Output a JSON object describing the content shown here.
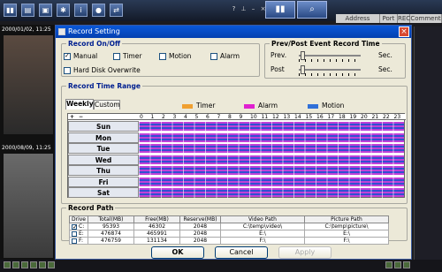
{
  "background": {
    "table_headers": [
      "Address",
      "Port",
      "REC",
      "Comment"
    ],
    "camera_timestamps": [
      "2000/01/02, 11:25",
      "2000/08/09, 11:25"
    ]
  },
  "dialog": {
    "title": "Record Setting",
    "close_glyph": "×",
    "record_onoff": {
      "legend": "Record On/Off",
      "options": [
        {
          "label": "Manual",
          "checked": true
        },
        {
          "label": "Timer",
          "checked": false
        },
        {
          "label": "Motion",
          "checked": false
        },
        {
          "label": "Alarm",
          "checked": false
        }
      ],
      "hdd_overwrite": {
        "label": "Hard Disk Overwrite",
        "checked": false
      }
    },
    "prepost": {
      "legend": "Prev/Post Event Record Time",
      "prev_label": "Prev.",
      "post_label": "Post",
      "unit": "Sec."
    },
    "time_range": {
      "legend": "Record Time Range",
      "tabs": [
        "Weekly",
        "Custom"
      ],
      "active_tab": "Weekly",
      "legend_items": [
        {
          "label": "Timer",
          "color": "#f0a030"
        },
        {
          "label": "Alarm",
          "color": "#e020d0"
        },
        {
          "label": "Motion",
          "color": "#3070d8"
        }
      ],
      "add_glyph": "+",
      "remove_glyph": "−",
      "hours": [
        "0",
        "1",
        "2",
        "3",
        "4",
        "5",
        "6",
        "7",
        "8",
        "9",
        "10",
        "11",
        "12",
        "13",
        "14",
        "15",
        "16",
        "17",
        "18",
        "19",
        "20",
        "21",
        "22",
        "23"
      ],
      "days": [
        "Sun",
        "Mon",
        "Tue",
        "Wed",
        "Thu",
        "Fri",
        "Sat"
      ]
    },
    "record_path": {
      "legend": "Record Path",
      "headers": [
        "Drive",
        "Total(MB)",
        "Free(MB)",
        "Reserve(MB)",
        "Video Path",
        "Picture Path"
      ],
      "rows": [
        {
          "checked": true,
          "drive": "C:",
          "total": "95393",
          "free": "46302",
          "reserve": "2048",
          "video": "C:\\temp\\video\\",
          "picture": "C:\\temp\\picture\\"
        },
        {
          "checked": false,
          "drive": "E:",
          "total": "476874",
          "free": "465991",
          "reserve": "2048",
          "video": "E:\\",
          "picture": "E:\\"
        },
        {
          "checked": false,
          "drive": "F:",
          "total": "476759",
          "free": "131134",
          "reserve": "2048",
          "video": "F:\\",
          "picture": "F:\\"
        }
      ]
    },
    "buttons": {
      "ok": "OK",
      "cancel": "Cancel",
      "apply": "Apply"
    }
  }
}
